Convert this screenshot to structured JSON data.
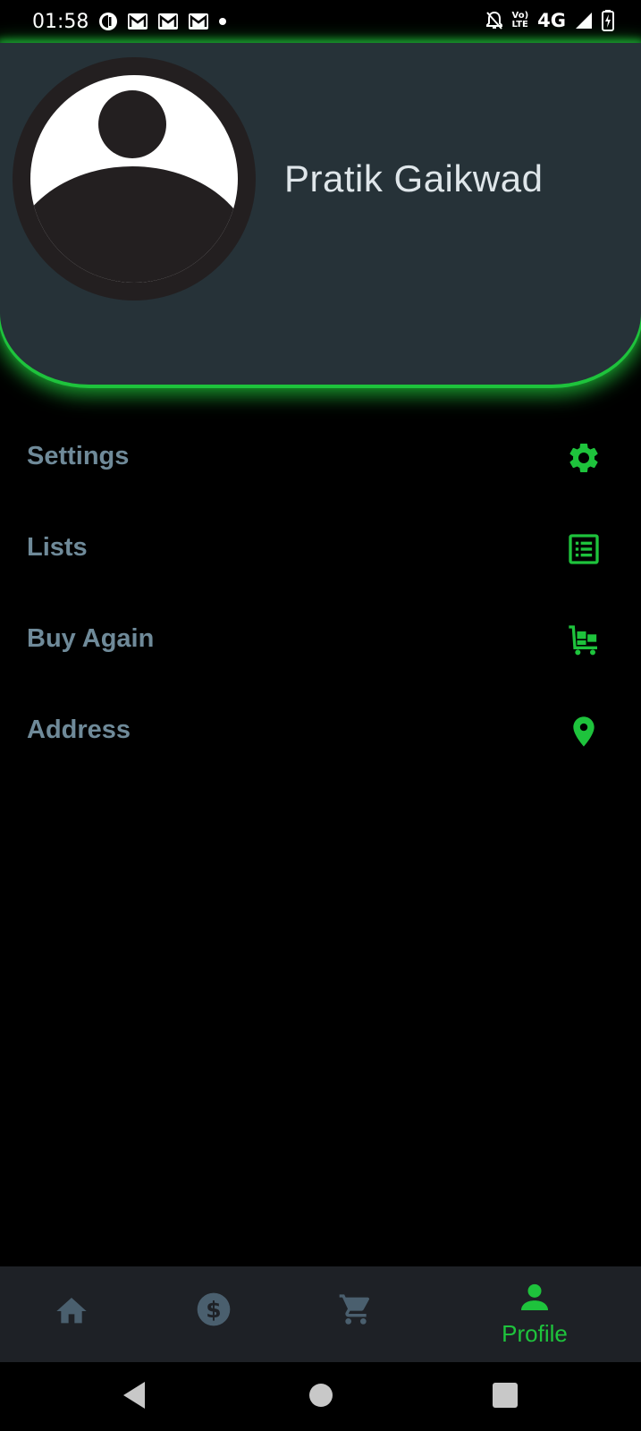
{
  "status_bar": {
    "time": "01:58",
    "network": "4G",
    "volte_top": "Vo)",
    "volte_bottom": "LTE"
  },
  "profile": {
    "name": "Pratik Gaikwad"
  },
  "menu": {
    "items": [
      {
        "label": "Settings",
        "icon": "gear-icon"
      },
      {
        "label": "Lists",
        "icon": "list-icon"
      },
      {
        "label": "Buy Again",
        "icon": "cart-reorder-icon"
      },
      {
        "label": "Address",
        "icon": "location-pin-icon"
      }
    ]
  },
  "bottom_nav": {
    "items": [
      {
        "icon": "home-icon",
        "label": ""
      },
      {
        "icon": "dollar-icon",
        "label": ""
      },
      {
        "icon": "cart-icon",
        "label": ""
      },
      {
        "icon": "person-icon",
        "label": "Profile"
      }
    ],
    "active_color": "#1ec33c",
    "inactive_color": "#4a5f6e"
  },
  "colors": {
    "accent": "#1ec33c",
    "header_bg": "#263238",
    "menu_text": "#6f8a99"
  }
}
